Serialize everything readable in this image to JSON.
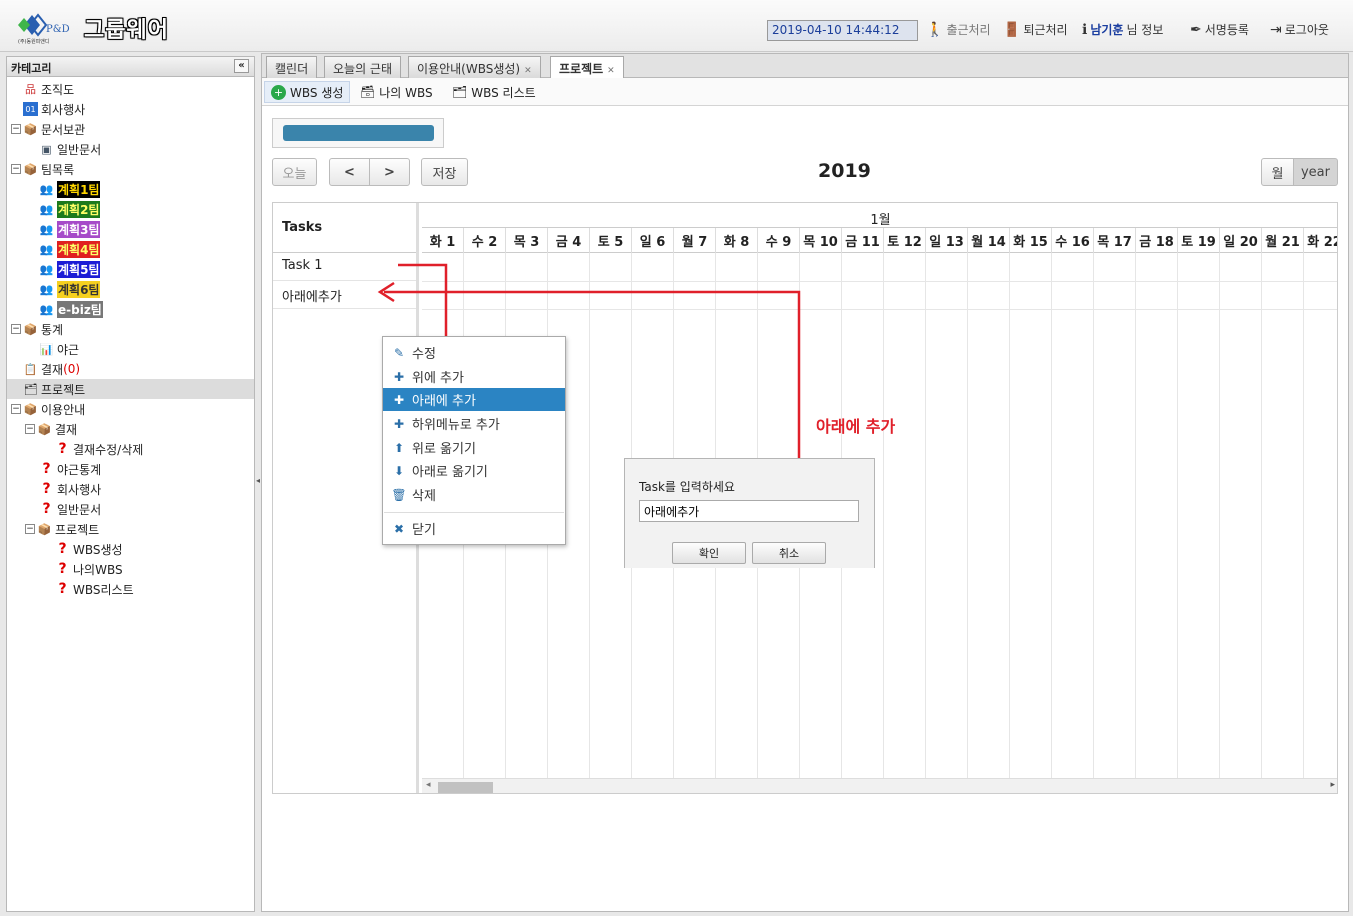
{
  "header": {
    "logo_text": "(주)동원피앤디",
    "logo_mark": "P&D",
    "app_title": "그룹웨어",
    "datetime": "2019-04-10 14:44:12",
    "links": {
      "checkin": "출근처리",
      "checkout": "퇴근처리",
      "user_name": "남기훈",
      "user_suffix": "님 정보",
      "signature": "서명등록",
      "logout": "로그아웃"
    }
  },
  "sidebar": {
    "title": "카테고리",
    "collapse_glyph": "«",
    "items": [
      {
        "label": "조직도"
      },
      {
        "label": "회사행사"
      },
      {
        "label": "문서보관"
      },
      {
        "label": "일반문서"
      },
      {
        "label": "팀목록"
      },
      {
        "label": "계획1팀"
      },
      {
        "label": "계획2팀"
      },
      {
        "label": "계획3팀"
      },
      {
        "label": "계획4팀"
      },
      {
        "label": "계획5팀"
      },
      {
        "label": "계획6팀"
      },
      {
        "label": "e-biz팀"
      },
      {
        "label": "통계"
      },
      {
        "label": "야근"
      },
      {
        "label": "결재",
        "count": "(0)"
      },
      {
        "label": "프로젝트"
      },
      {
        "label": "이용안내"
      },
      {
        "label": "결재"
      },
      {
        "label": "결재수정/삭제"
      },
      {
        "label": "야근통계"
      },
      {
        "label": "회사행사"
      },
      {
        "label": "일반문서"
      },
      {
        "label": "프로젝트"
      },
      {
        "label": "WBS생성"
      },
      {
        "label": "나의WBS"
      },
      {
        "label": "WBS리스트"
      }
    ],
    "team_colors": {
      "team1": {
        "bg": "#000000",
        "fg": "#ffd700"
      },
      "team2": {
        "bg": "#1c7a1c",
        "fg": "#ffff66"
      },
      "team3": {
        "bg": "#a64ac9",
        "fg": "#ffffff"
      },
      "team4": {
        "bg": "#e02020",
        "fg": "#ffff66"
      },
      "team5": {
        "bg": "#1c1cd6",
        "fg": "#ffffff"
      },
      "team6": {
        "bg": "#f5d020",
        "fg": "#333333"
      },
      "ebiz": {
        "bg": "#777777",
        "fg": "#ffffff"
      }
    }
  },
  "tabs": [
    {
      "label": "캘린더",
      "closable": false
    },
    {
      "label": "오늘의 근태",
      "closable": false
    },
    {
      "label": "이용안내(WBS생성)",
      "closable": true
    },
    {
      "label": "프로젝트",
      "closable": true,
      "active": true
    }
  ],
  "toolbar": {
    "wbs_create": "WBS 생성",
    "my_wbs": "나의 WBS",
    "wbs_list": "WBS 리스트"
  },
  "gantt": {
    "today_label": "오늘",
    "prev_glyph": "<",
    "next_glyph": ">",
    "save_label": "저장",
    "year_title": "2019",
    "view_month": "월",
    "view_year": "year",
    "tasks_header": "Tasks",
    "tasks": [
      "Task 1",
      "아래에추가"
    ],
    "month_label": "1월",
    "days": [
      "화 1",
      "수 2",
      "목 3",
      "금 4",
      "토 5",
      "일 6",
      "월 7",
      "화 8",
      "수 9",
      "목 10",
      "금 11",
      "토 12",
      "일 13",
      "월 14",
      "화 15",
      "수 16",
      "목 17",
      "금 18",
      "토 19",
      "일 20",
      "월 21",
      "화 22"
    ]
  },
  "context_menu": {
    "items": [
      {
        "label": "수정",
        "icon": "edit-icon",
        "glyph": "✎"
      },
      {
        "label": "위에 추가",
        "icon": "plus-icon",
        "glyph": "✚"
      },
      {
        "label": "아래에 추가",
        "icon": "plus-icon",
        "glyph": "✚",
        "active": true
      },
      {
        "label": "하위메뉴로 추가",
        "icon": "plus-icon",
        "glyph": "✚"
      },
      {
        "label": "위로 옮기기",
        "icon": "up-circle-icon",
        "glyph": "⬆"
      },
      {
        "label": "아래로 옮기기",
        "icon": "down-circle-icon",
        "glyph": "⬇"
      },
      {
        "label": "삭제",
        "icon": "trash-icon",
        "glyph": "🗑"
      },
      {
        "label": "닫기",
        "icon": "close-icon",
        "glyph": "✖"
      }
    ]
  },
  "dialog": {
    "label": "Task를 입력하세요",
    "value": "아래에추가",
    "ok_label": "확인",
    "cancel_label": "취소"
  },
  "annotation": {
    "text": "아래에 추가",
    "color": "#e0202a"
  }
}
